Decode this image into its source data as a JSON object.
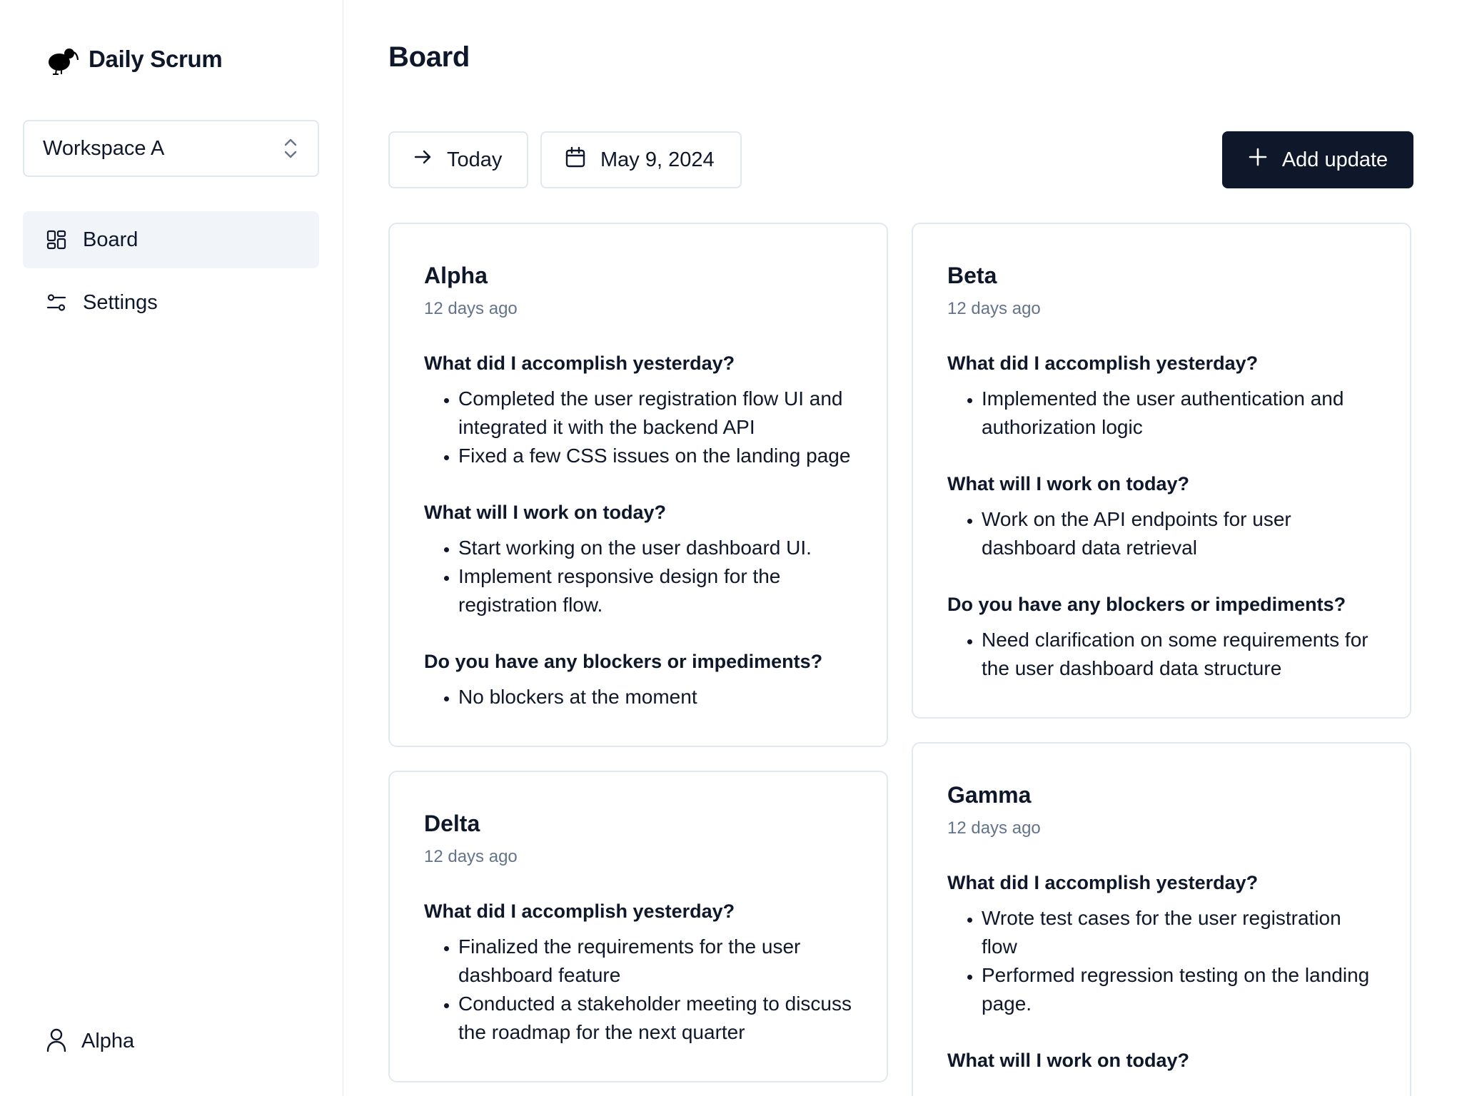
{
  "app": {
    "name": "Daily Scrum"
  },
  "sidebar": {
    "workspace": "Workspace A",
    "nav": [
      {
        "label": "Board",
        "active": true
      },
      {
        "label": "Settings",
        "active": false
      }
    ],
    "user": "Alpha"
  },
  "header": {
    "title": "Board"
  },
  "toolbar": {
    "today_label": "Today",
    "date_label": "May 9, 2024",
    "add_label": "Add update"
  },
  "colors": {
    "accent": "#0f172a",
    "muted": "#64748b",
    "border": "#e2e8f0",
    "active_bg": "#f1f5f9"
  },
  "cards": [
    {
      "name": "Alpha",
      "time": "12 days ago",
      "sections": [
        {
          "question": "What did I accomplish yesterday?",
          "items": [
            "Completed the user registration flow UI and integrated it with the backend API",
            "Fixed a few CSS issues on the landing page"
          ]
        },
        {
          "question": "What will I work on today?",
          "items": [
            "Start working on the user dashboard UI.",
            "Implement responsive design for the registration flow."
          ]
        },
        {
          "question": "Do you have any blockers or impediments?",
          "items": [
            "No blockers at the moment"
          ]
        }
      ]
    },
    {
      "name": "Beta",
      "time": "12 days ago",
      "sections": [
        {
          "question": "What did I accomplish yesterday?",
          "items": [
            "Implemented the user authentication and authorization logic"
          ]
        },
        {
          "question": "What will I work on today?",
          "items": [
            "Work on the API endpoints for user dashboard data retrieval"
          ]
        },
        {
          "question": "Do you have any blockers or impediments?",
          "items": [
            "Need clarification on some requirements for the user dashboard data structure"
          ]
        }
      ]
    },
    {
      "name": "Delta",
      "time": "12 days ago",
      "sections": [
        {
          "question": "What did I accomplish yesterday?",
          "items": [
            "Finalized the requirements for the user dashboard feature",
            "Conducted a stakeholder meeting to discuss the roadmap for the next quarter"
          ]
        }
      ]
    },
    {
      "name": "Gamma",
      "time": "12 days ago",
      "sections": [
        {
          "question": "What did I accomplish yesterday?",
          "items": [
            "Wrote test cases for the user registration flow",
            "Performed regression testing on the landing page."
          ]
        },
        {
          "question": "What will I work on today?",
          "items": []
        }
      ]
    }
  ]
}
